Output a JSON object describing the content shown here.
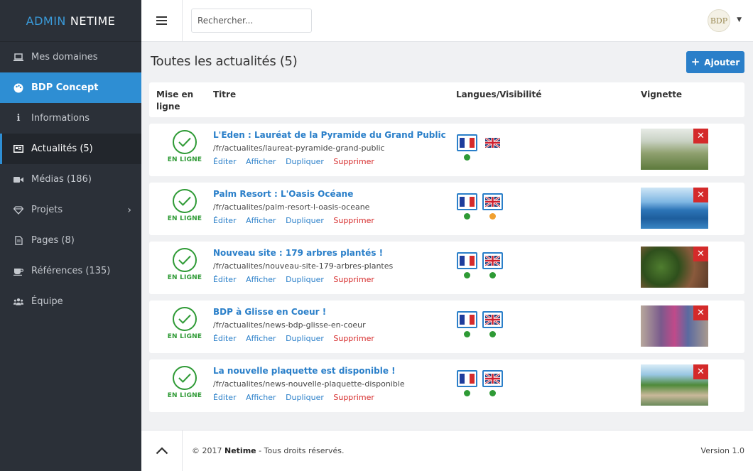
{
  "brand": {
    "part1": "ADMIN",
    "part2": "NETIME"
  },
  "sidebar": {
    "items": [
      {
        "label": "Mes domaines",
        "icon": "laptop-icon"
      },
      {
        "label": "BDP Concept",
        "icon": "palette-icon"
      },
      {
        "label": "Informations",
        "icon": "info-icon"
      },
      {
        "label": "Actualités (5)",
        "icon": "newspaper-icon"
      },
      {
        "label": "Médias (186)",
        "icon": "video-icon"
      },
      {
        "label": "Projets",
        "icon": "diamond-icon"
      },
      {
        "label": "Pages (8)",
        "icon": "file-icon"
      },
      {
        "label": "Références (135)",
        "icon": "coffee-icon"
      },
      {
        "label": "Équipe",
        "icon": "users-icon"
      }
    ]
  },
  "topbar": {
    "search_placeholder": "Rechercher...",
    "avatar_text": "BDP"
  },
  "main": {
    "title": "Toutes les actualités (5)",
    "add_button": "Ajouter",
    "columns": {
      "status": "Mise en ligne",
      "title": "Titre",
      "langs": "Langues/Visibilité",
      "thumb": "Vignette"
    }
  },
  "actions": {
    "edit": "Éditer",
    "view": "Afficher",
    "duplicate": "Dupliquer",
    "delete": "Supprimer"
  },
  "rows": [
    {
      "status": "EN LIGNE",
      "title": "L'Eden : Lauréat de la Pyramide du Grand Public",
      "path": "/fr/actualites/laureat-pyramide-grand-public",
      "fr_dot": "#2e9a35",
      "en_dot": null
    },
    {
      "status": "EN LIGNE",
      "title": "Palm Resort : L'Oasis Océane",
      "path": "/fr/actualites/palm-resort-l-oasis-oceane",
      "fr_dot": "#2e9a35",
      "en_dot": "#f0a030"
    },
    {
      "status": "EN LIGNE",
      "title": "Nouveau site : 179 arbres plantés !",
      "path": "/fr/actualites/nouveau-site-179-arbres-plantes",
      "fr_dot": "#2e9a35",
      "en_dot": "#2e9a35"
    },
    {
      "status": "EN LIGNE",
      "title": "BDP à Glisse en Coeur !",
      "path": "/fr/actualites/news-bdp-glisse-en-coeur",
      "fr_dot": "#2e9a35",
      "en_dot": "#2e9a35"
    },
    {
      "status": "EN LIGNE",
      "title": "La nouvelle plaquette est disponible !",
      "path": "/fr/actualites/news-nouvelle-plaquette-disponible",
      "fr_dot": "#2e9a35",
      "en_dot": "#2e9a35"
    }
  ],
  "footer": {
    "copyright_prefix": "© 2017",
    "company": "Netime",
    "copyright_suffix": "- Tous droits réservés.",
    "version": "Version 1.0"
  },
  "colors": {
    "accent": "#2e8ed3",
    "online": "#2e9a35",
    "danger": "#d42a2a",
    "warning": "#f0a030"
  }
}
